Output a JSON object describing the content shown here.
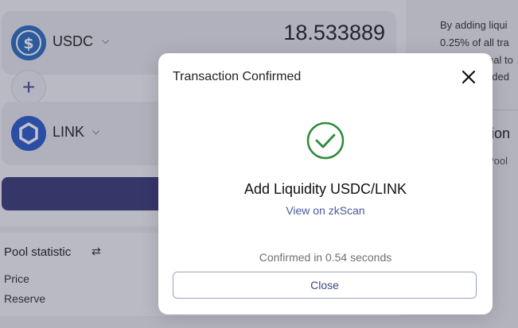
{
  "pair": {
    "token_a": {
      "symbol": "USDC",
      "amount": "18.533889",
      "icon": "usdc-icon",
      "color": "#2d6ec0"
    },
    "token_b": {
      "symbol": "LINK",
      "icon": "chainlink-icon",
      "color": "#2d5cc8"
    },
    "add_icon": "plus-icon"
  },
  "stats": {
    "title": "Pool statistic",
    "price_label": "Price",
    "reserve_label": "Reserve"
  },
  "side": {
    "line1": "By adding liqui",
    "line2": "0.25% of all tra",
    "line3": "nal to",
    "line4": "dded",
    "heading": "ction",
    "sub": "Pool"
  },
  "modal": {
    "title": "Transaction Confirmed",
    "status_title": "Add Liquidity USDC/LINK",
    "link_text": "View on zkScan",
    "confirm_text": "Confirmed in 0.54 seconds",
    "close_label": "Close",
    "accent_color": "#2e8b3a"
  }
}
